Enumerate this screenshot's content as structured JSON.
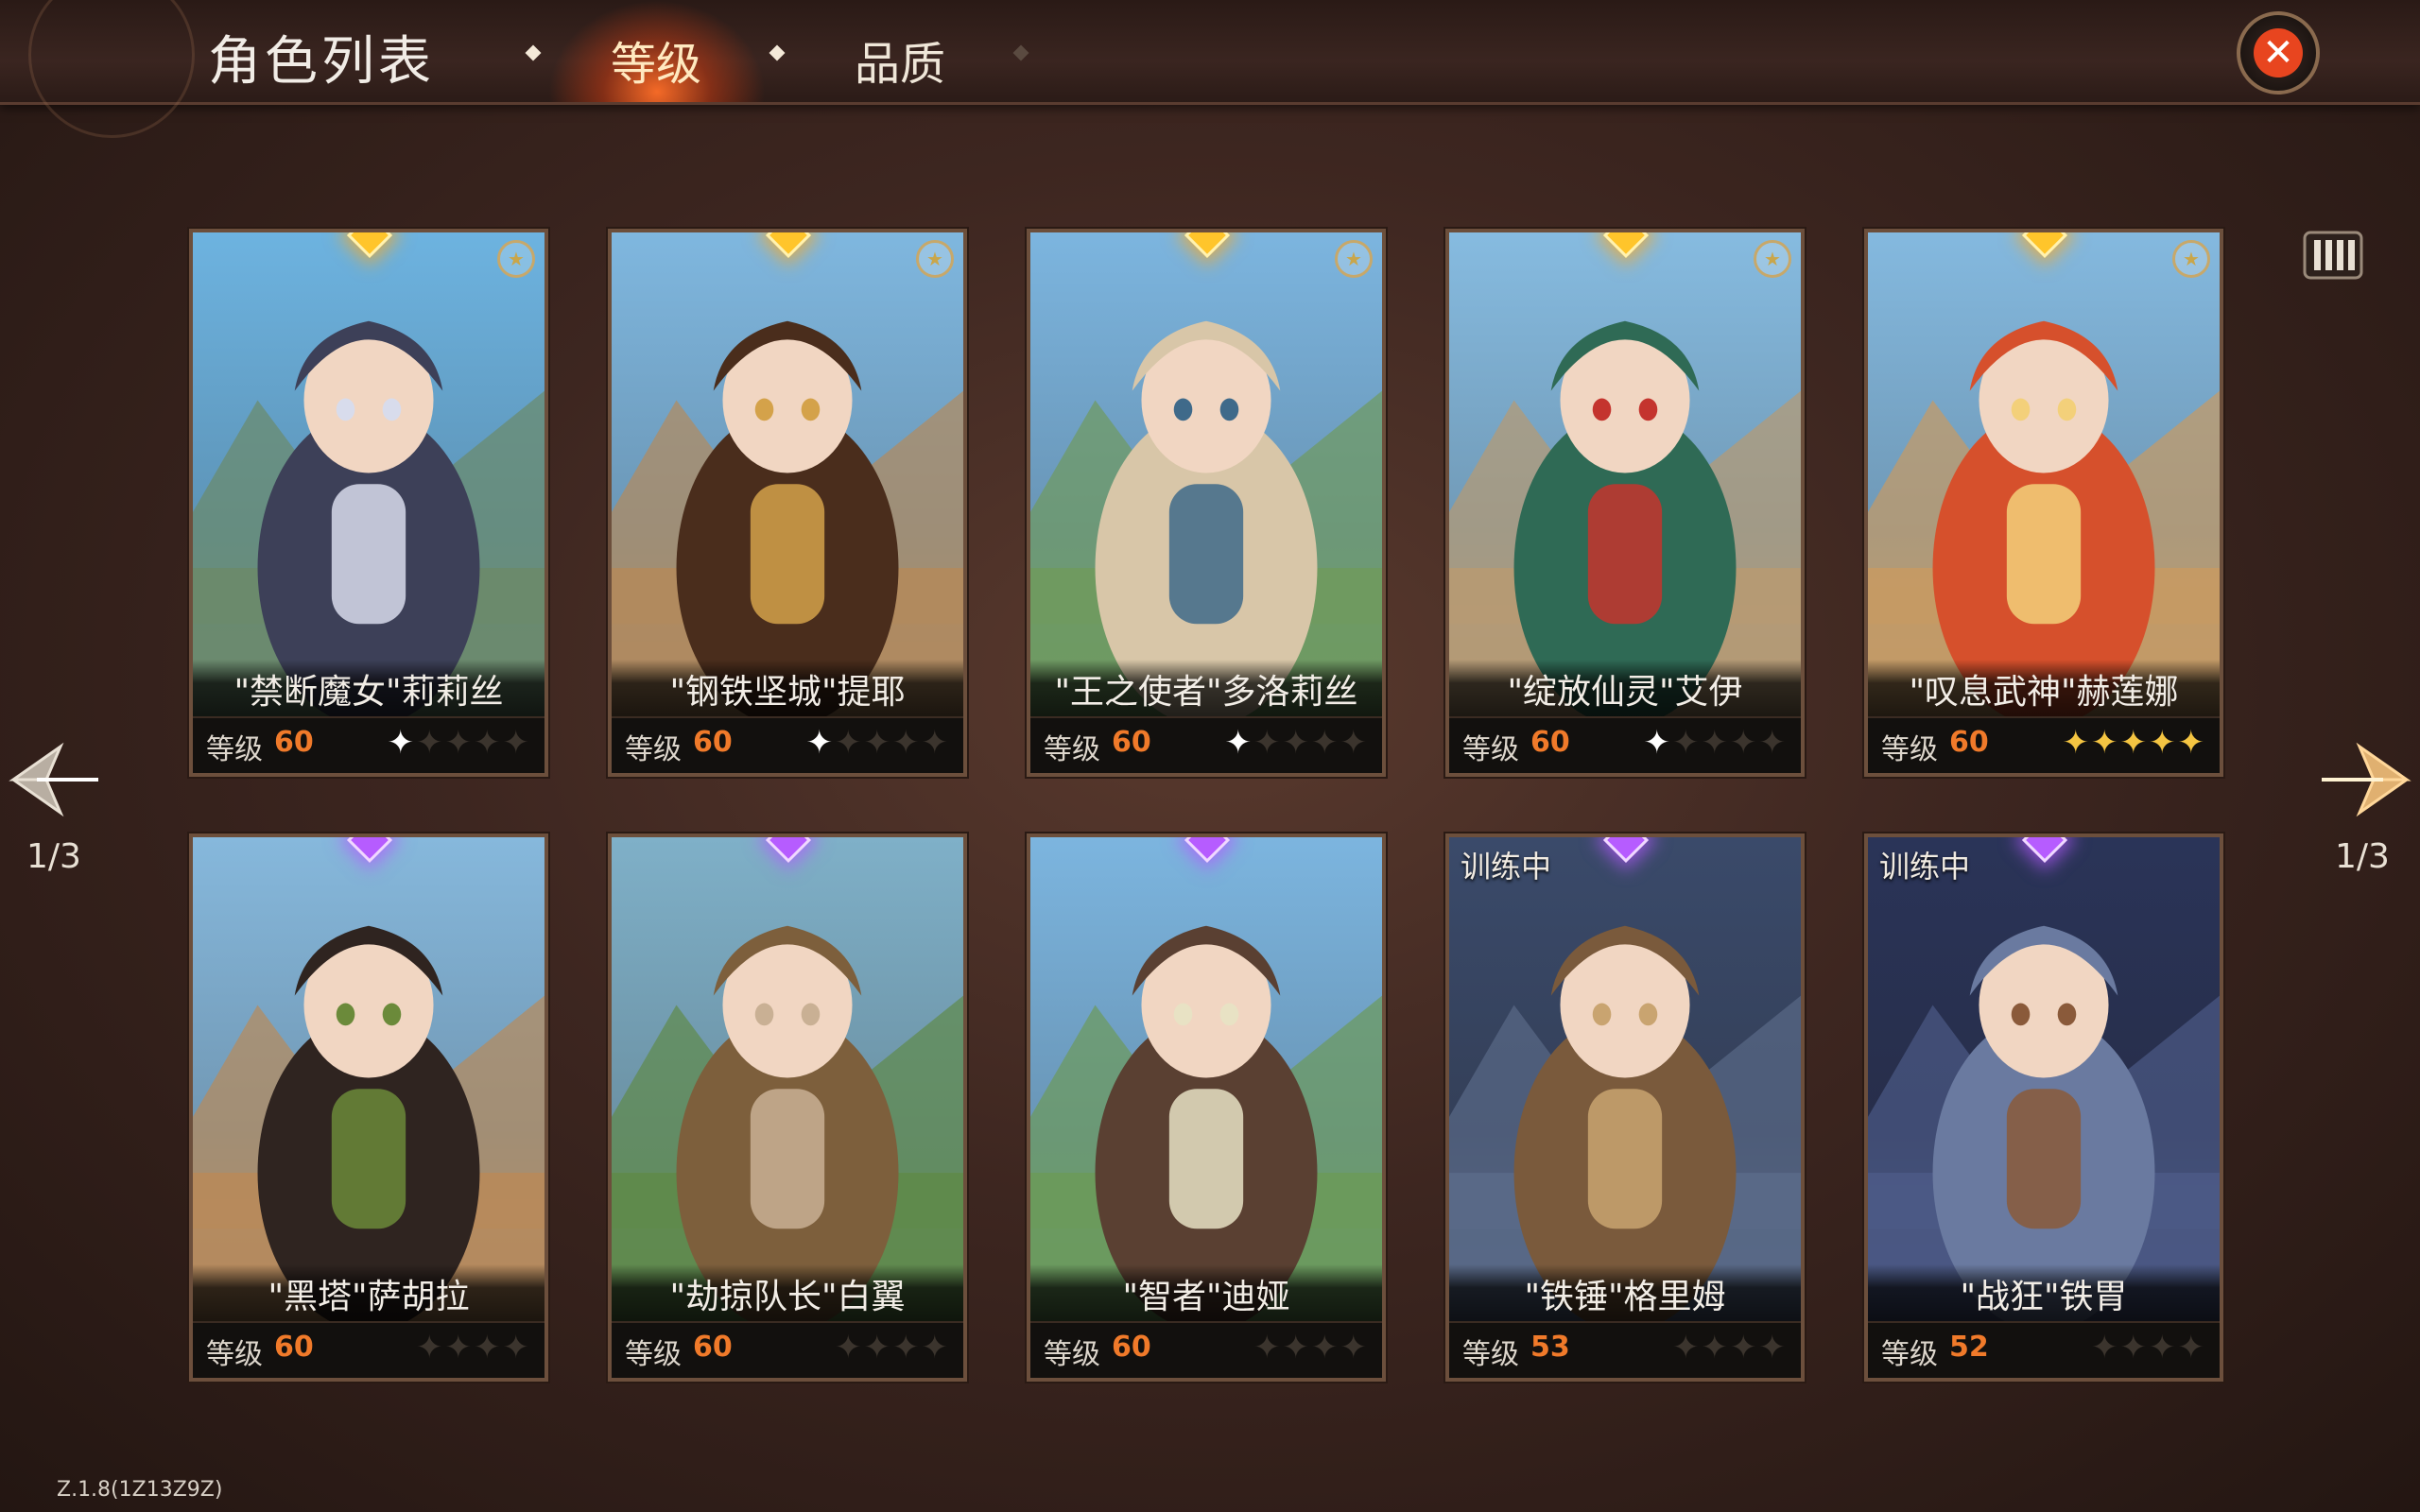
{
  "header": {
    "title": "角色列表",
    "tabs": [
      {
        "label": "等级",
        "active": true
      },
      {
        "label": "品质",
        "active": false
      }
    ],
    "close_icon": "close-icon"
  },
  "pagination": {
    "left": "1/3",
    "right": "1/3"
  },
  "level_label": "等级",
  "cards": [
    {
      "name": "\"禁断魔女\"莉莉丝",
      "level": "60",
      "gem": "gold",
      "stars": 1,
      "star_style": "white",
      "favorite": true,
      "training": "",
      "palette": [
        "#6db3e0",
        "#6b8a6a",
        "#3d4058",
        "#d8dcec"
      ]
    },
    {
      "name": "\"钢铁坚城\"提耶",
      "level": "60",
      "gem": "gold",
      "stars": 1,
      "star_style": "white",
      "favorite": true,
      "training": "",
      "palette": [
        "#7fb7df",
        "#b38a5c",
        "#4a2d1c",
        "#d4a24a"
      ]
    },
    {
      "name": "\"王之使者\"多洛莉丝",
      "level": "60",
      "gem": "gold",
      "stars": 1,
      "star_style": "white",
      "favorite": true,
      "training": "",
      "palette": [
        "#7cb5df",
        "#6f9a5e",
        "#d8c6a8",
        "#3f6a8a"
      ]
    },
    {
      "name": "\"绽放仙灵\"艾伊",
      "level": "60",
      "gem": "gold",
      "stars": 1,
      "star_style": "white",
      "favorite": true,
      "training": "",
      "palette": [
        "#86bbe0",
        "#b79a72",
        "#2f6a55",
        "#c4342e"
      ]
    },
    {
      "name": "\"叹息武神\"赫莲娜",
      "level": "60",
      "gem": "gold",
      "stars": 5,
      "star_style": "gold",
      "favorite": true,
      "training": "",
      "palette": [
        "#84b9df",
        "#c79a63",
        "#d6502c",
        "#f3d07a"
      ]
    },
    {
      "name": "\"黑塔\"萨胡拉",
      "level": "60",
      "gem": "purple",
      "stars": 0,
      "star_style": "white",
      "favorite": false,
      "training": "",
      "palette": [
        "#86b8dc",
        "#b88a5a",
        "#2f2420",
        "#6b8a3a"
      ]
    },
    {
      "name": "\"劫掠队长\"白翼",
      "level": "60",
      "gem": "purple",
      "stars": 0,
      "star_style": "white",
      "favorite": false,
      "training": "",
      "palette": [
        "#7fb0c8",
        "#5f8a4a",
        "#7d5f3c",
        "#c9b094"
      ]
    },
    {
      "name": "\"智者\"迪娅",
      "level": "60",
      "gem": "purple",
      "stars": 0,
      "star_style": "white",
      "favorite": false,
      "training": "",
      "palette": [
        "#7cb5df",
        "#6c9a5a",
        "#5a4032",
        "#e8e2c4"
      ]
    },
    {
      "name": "\"铁锤\"格里姆",
      "level": "53",
      "gem": "purple",
      "stars": 0,
      "star_style": "white",
      "favorite": false,
      "training": "训练中",
      "palette": [
        "#3a4a6a",
        "#5a6a88",
        "#7a5a3c",
        "#c9a470"
      ]
    },
    {
      "name": "\"战狂\"铁胃",
      "level": "52",
      "gem": "purple",
      "stars": 0,
      "star_style": "white",
      "favorite": false,
      "training": "训练中",
      "palette": [
        "#2a3458",
        "#4c5a86",
        "#6a7aa0",
        "#8a5a3a"
      ]
    }
  ],
  "version": "Z.1.8(1Z13Z9Z)"
}
